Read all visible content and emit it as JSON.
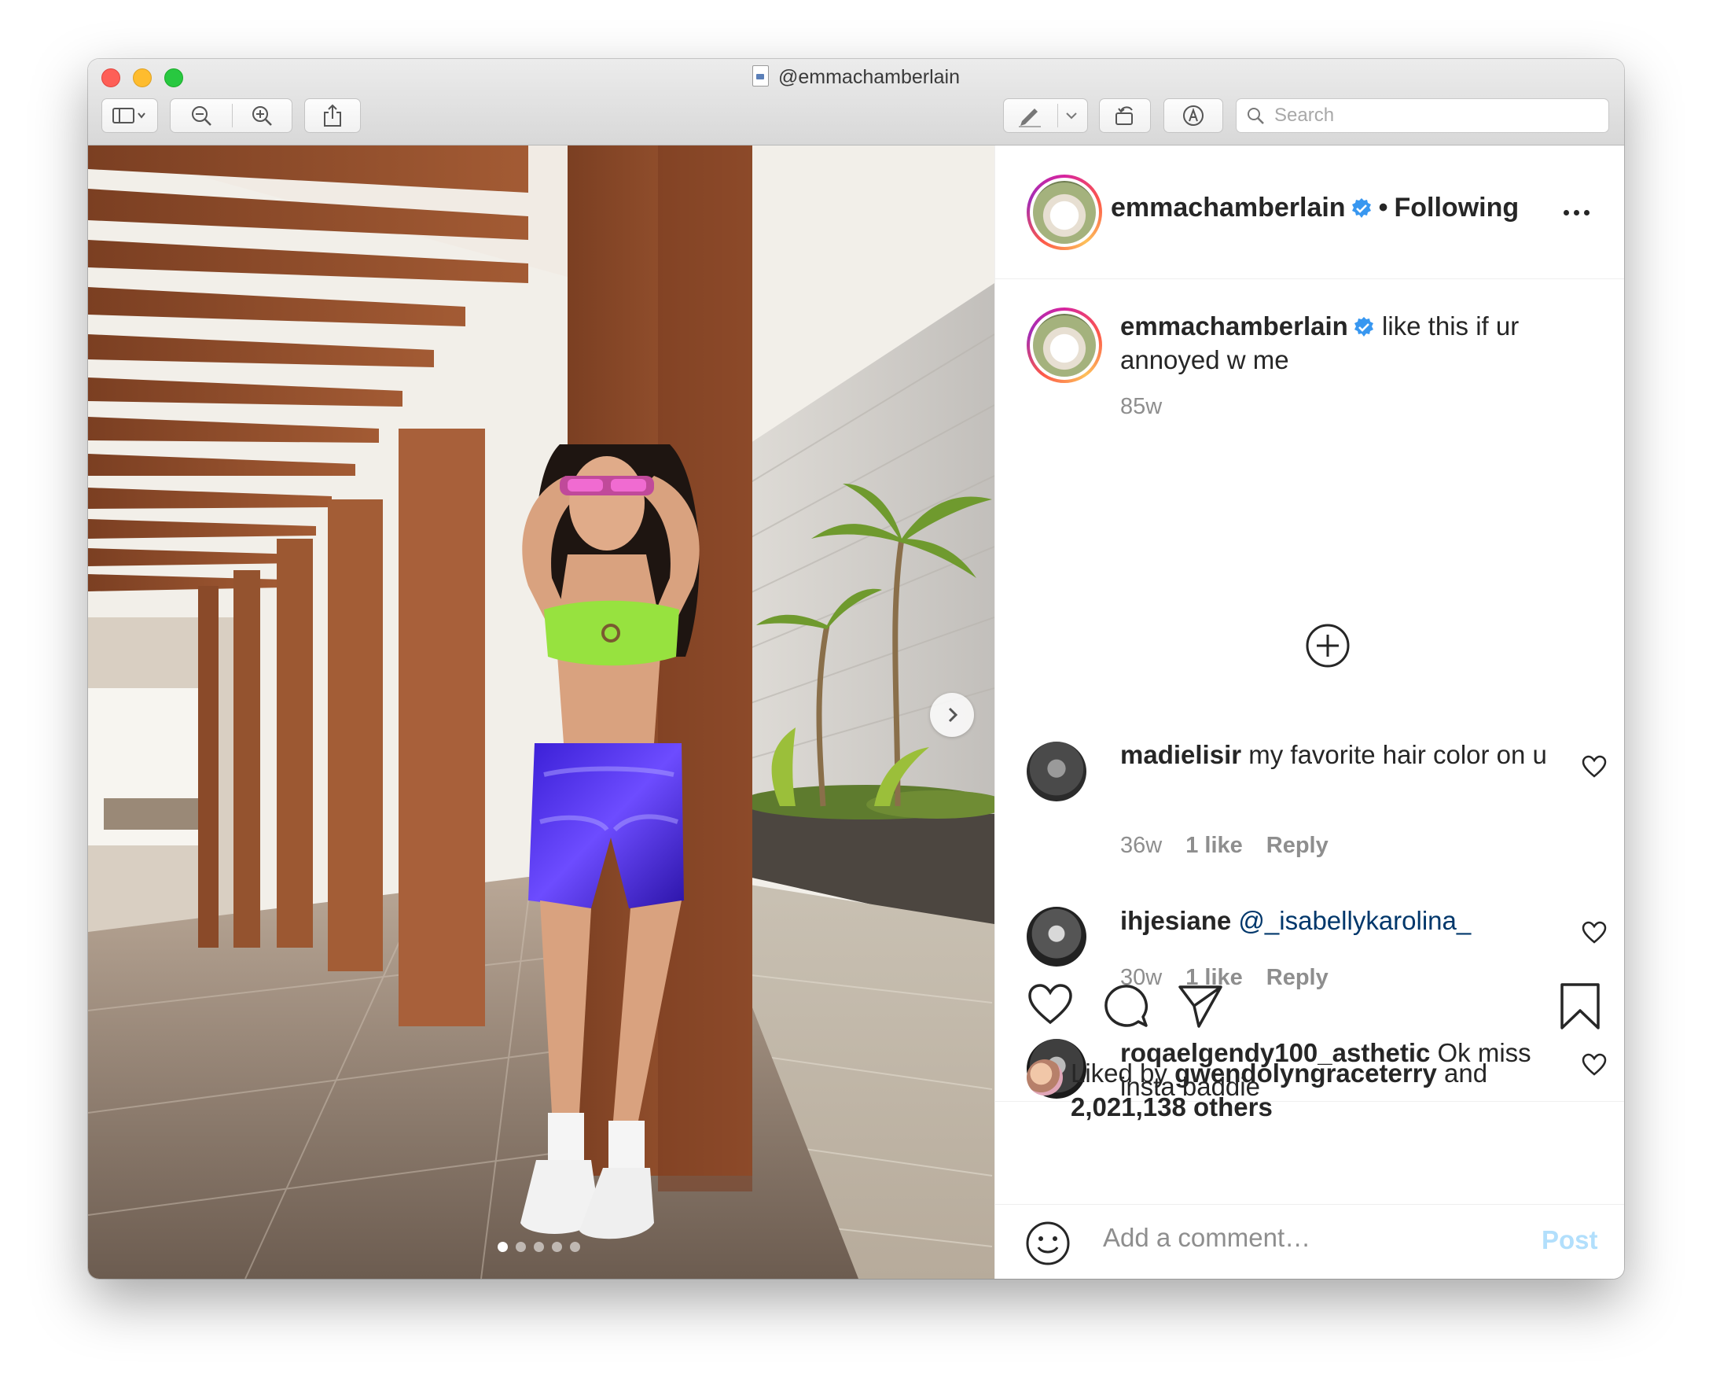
{
  "window": {
    "title": "@emmachamberlain",
    "search_placeholder": "Search"
  },
  "toolbar": {
    "icons": [
      "sidebar-icon",
      "zoom-out-icon",
      "zoom-in-icon",
      "share-icon",
      "markup-pen-icon",
      "rotate-icon",
      "annotate-icon",
      "search-icon"
    ]
  },
  "photo": {
    "carousel_pages": 5,
    "active_page": 1
  },
  "post": {
    "author": "emmachamberlain",
    "follow_separator": "•",
    "follow_status": "Following",
    "caption_user": "emmachamberlain",
    "caption_text": "like this if ur annoyed w me",
    "caption_age": "85w",
    "comments": [
      {
        "user": "madielisir",
        "text": "my favorite hair color on u",
        "age": "36w",
        "likes": "1 like",
        "reply": "Reply"
      },
      {
        "user": "ihjesiane",
        "mention": "@_isabellykarolina_",
        "age": "30w",
        "likes": "1 like",
        "reply": "Reply"
      },
      {
        "user": "roqaelgendy100_asthetic",
        "text": "Ok miss insta baddie"
      }
    ],
    "liked_by_prefix": "Liked by",
    "liked_by_user": "gwendolyngraceterry",
    "liked_by_and": "and",
    "liked_by_others": "2,021,138 others",
    "comment_placeholder": "Add a comment…",
    "post_label": "Post"
  },
  "colors": {
    "verified_blue": "#3897f0",
    "link_blue": "#00376b",
    "post_disabled": "#b2dffc",
    "text": "#262626",
    "secondary_text": "#8e8e8e"
  }
}
